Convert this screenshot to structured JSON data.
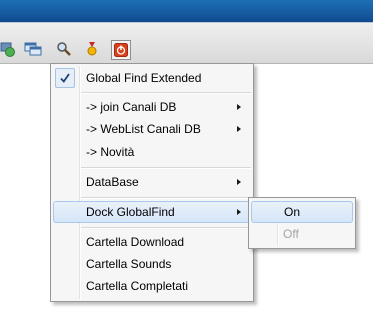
{
  "toolbar": {
    "icons": [
      "network-icon",
      "windows-icon",
      "search-icon",
      "medal-icon",
      "power-icon"
    ]
  },
  "menu": {
    "items": [
      {
        "label": "Global Find Extended",
        "checked": true
      },
      {
        "label": "-> join Canali DB",
        "submenu": true
      },
      {
        "label": "-> WebList Canali DB",
        "submenu": true
      },
      {
        "label": "-> Novità"
      },
      {
        "label": "DataBase",
        "submenu": true
      },
      {
        "label": "Dock GlobalFind",
        "submenu": true,
        "highlighted": true
      },
      {
        "label": "Cartella Download"
      },
      {
        "label": "Cartella Sounds"
      },
      {
        "label": "Cartella Completati"
      }
    ]
  },
  "submenu": {
    "items": [
      {
        "label": "On",
        "highlighted": true
      },
      {
        "label": "Off",
        "disabled": true
      }
    ]
  }
}
